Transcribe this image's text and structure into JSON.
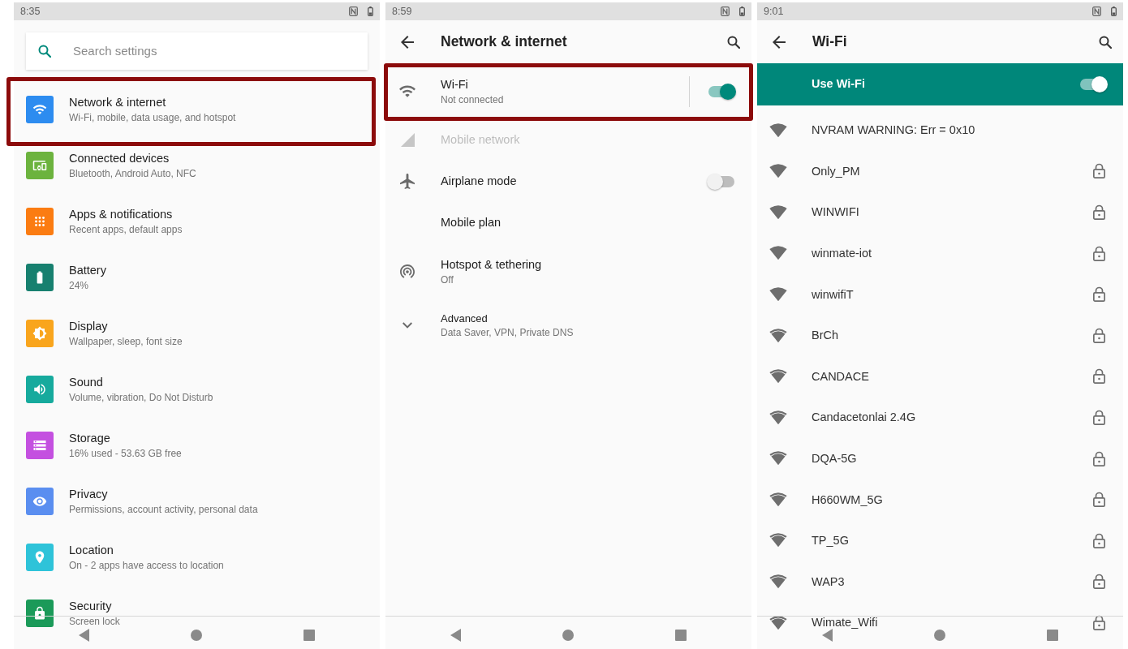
{
  "settings": {
    "status_bar": {
      "time": "8:35"
    },
    "search": {
      "placeholder": "Search settings"
    },
    "items": [
      {
        "title": "Network & internet",
        "subtitle": "Wi-Fi, mobile, data usage, and hotspot",
        "color": "#2d8cf0",
        "highlighted": true
      },
      {
        "title": "Connected devices",
        "subtitle": "Bluetooth, Android Auto, NFC",
        "color": "#6cb33e",
        "highlighted": false
      },
      {
        "title": "Apps & notifications",
        "subtitle": "Recent apps, default apps",
        "color": "#fb7c12",
        "highlighted": false
      },
      {
        "title": "Battery",
        "subtitle": "24%",
        "color": "#17806f",
        "highlighted": false
      },
      {
        "title": "Display",
        "subtitle": "Wallpaper, sleep, font size",
        "color": "#f9a51d",
        "highlighted": false
      },
      {
        "title": "Sound",
        "subtitle": "Volume, vibration, Do Not Disturb",
        "color": "#16aa9d",
        "highlighted": false
      },
      {
        "title": "Storage",
        "subtitle": "16% used - 53.63 GB free",
        "color": "#c450e0",
        "highlighted": false
      },
      {
        "title": "Privacy",
        "subtitle": "Permissions, account activity, personal data",
        "color": "#5a8ef0",
        "highlighted": false
      },
      {
        "title": "Location",
        "subtitle": "On - 2 apps have access to location",
        "color": "#2ec3d9",
        "highlighted": false
      },
      {
        "title": "Security",
        "subtitle": "Screen lock",
        "color": "#1b9a59",
        "highlighted": false
      }
    ]
  },
  "network_internet": {
    "status_bar": {
      "time": "8:59"
    },
    "app_bar": {
      "title": "Network & internet"
    },
    "items": [
      {
        "kind": "split",
        "title": "Wi-Fi",
        "subtitle": "Not connected",
        "on": true,
        "disabled": false,
        "highlighted": true
      },
      {
        "kind": "plain",
        "title": "Mobile network",
        "disabled": true,
        "highlighted": false
      },
      {
        "kind": "toggle",
        "title": "Airplane mode",
        "on": false,
        "disabled": false,
        "highlighted": false
      },
      {
        "kind": "plain",
        "title": "Mobile plan",
        "disabled": false,
        "highlighted": false
      },
      {
        "kind": "plain",
        "title": "Hotspot & tethering",
        "subtitle": "Off",
        "disabled": false,
        "highlighted": false
      },
      {
        "kind": "expander",
        "title": "Advanced",
        "subtitle": "Data Saver, VPN, Private DNS",
        "disabled": false,
        "highlighted": false
      }
    ]
  },
  "wifi": {
    "status_bar": {
      "time": "9:01"
    },
    "app_bar": {
      "title": "Wi-Fi"
    },
    "master_switch": {
      "label": "Use Wi-Fi",
      "on": true
    },
    "networks": [
      {
        "name": "NVRAM WARNING: Err = 0x10",
        "kind": "strong",
        "secured": false
      },
      {
        "name": "Only_PM",
        "kind": "strong",
        "secured": true
      },
      {
        "name": "WINWIFI",
        "kind": "strong",
        "secured": true
      },
      {
        "name": "winmate-iot",
        "kind": "strong",
        "secured": true
      },
      {
        "name": "winwifiT",
        "kind": "strong",
        "secured": true
      },
      {
        "name": "BrCh",
        "kind": "medium",
        "secured": true
      },
      {
        "name": "CANDACE",
        "kind": "medium",
        "secured": true
      },
      {
        "name": "Candacetonlai 2.4G",
        "kind": "medium",
        "secured": true
      },
      {
        "name": "DQA-5G",
        "kind": "medium",
        "secured": true
      },
      {
        "name": "H660WM_5G",
        "kind": "medium",
        "secured": true
      },
      {
        "name": "TP_5G",
        "kind": "medium",
        "secured": true
      },
      {
        "name": "WAP3",
        "kind": "medium",
        "secured": true
      },
      {
        "name": "Wimate_Wifi",
        "kind": "medium",
        "secured": true
      }
    ]
  }
}
